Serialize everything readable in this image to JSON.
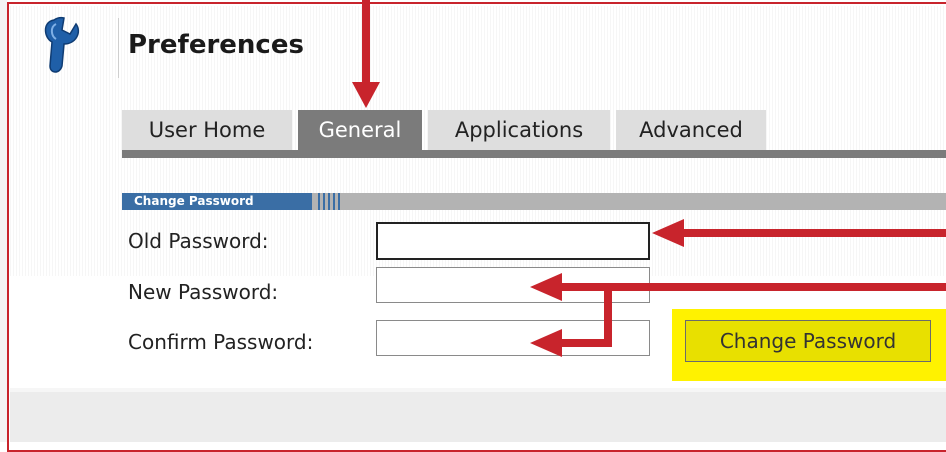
{
  "page": {
    "title": "Preferences"
  },
  "tabs": [
    {
      "label": "User Home",
      "active": false
    },
    {
      "label": "General",
      "active": true
    },
    {
      "label": "Applications",
      "active": false
    },
    {
      "label": "Advanced",
      "active": false
    }
  ],
  "section": {
    "title": "Change Password"
  },
  "form": {
    "old_password_label": "Old Password:",
    "new_password_label": "New Password:",
    "confirm_password_label": "Confirm Password:",
    "old_password_value": "",
    "new_password_value": "",
    "confirm_password_value": "",
    "submit_label": "Change Password"
  },
  "icons": {
    "logo": "wrench-icon"
  },
  "colors": {
    "annotation_red": "#c8242c",
    "highlight_yellow": "#fff200",
    "section_blue": "#3a6ea5",
    "tab_active": "#7b7b7b",
    "tab_inactive": "#dedede"
  }
}
